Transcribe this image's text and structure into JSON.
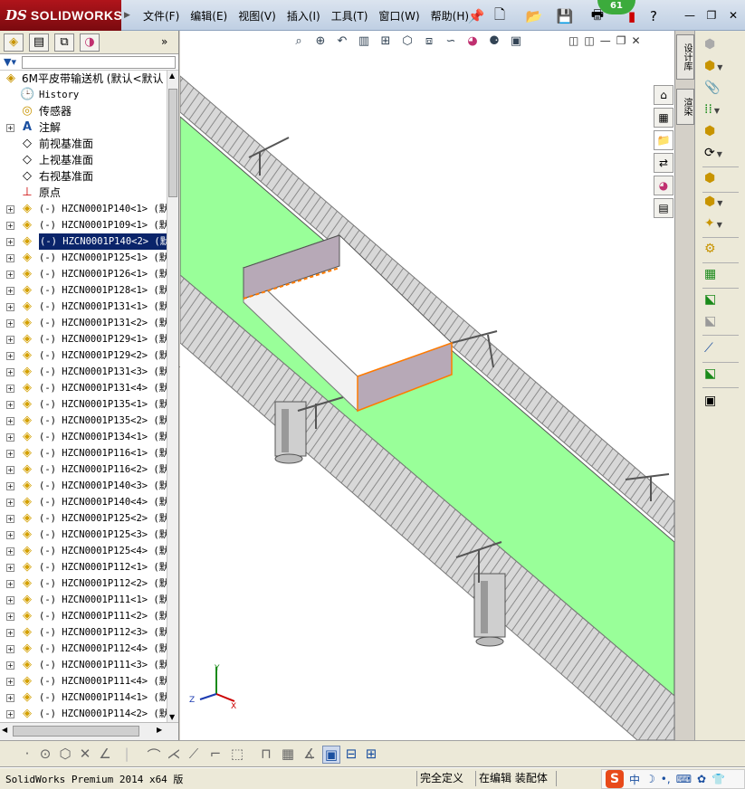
{
  "app": {
    "logo_ds": "DS",
    "logo_name": "SOLIDWORKS"
  },
  "menu": [
    "文件(F)",
    "编辑(E)",
    "视图(V)",
    "插入(I)",
    "工具(T)",
    "窗口(W)",
    "帮助(H)"
  ],
  "badge": "61",
  "tree": {
    "root": "6M平皮带输送机  (默认<默认",
    "fixed_items": [
      {
        "label": "History",
        "icon": "history-icon"
      },
      {
        "label": "传感器",
        "icon": "sensor-icon"
      },
      {
        "label": "注解",
        "icon": "annotation-icon"
      },
      {
        "label": "前视基准面",
        "icon": "plane-icon"
      },
      {
        "label": "上视基准面",
        "icon": "plane-icon"
      },
      {
        "label": "右视基准面",
        "icon": "plane-icon"
      },
      {
        "label": "原点",
        "icon": "origin-icon"
      }
    ],
    "components": [
      "(-) HZCN0001P140<1> (默",
      "(-) HZCN0001P109<1> (默",
      "(-) HZCN0001P140<2> (默",
      "(-) HZCN0001P125<1> (默",
      "(-) HZCN0001P126<1> (默",
      "(-) HZCN0001P128<1> (默",
      "(-) HZCN0001P131<1> (默",
      "(-) HZCN0001P131<2> (默",
      "(-) HZCN0001P129<1> (默",
      "(-) HZCN0001P129<2> (默",
      "(-) HZCN0001P131<3> (默",
      "(-) HZCN0001P131<4> (默",
      "(-) HZCN0001P135<1> (默",
      "(-) HZCN0001P135<2> (默",
      "(-) HZCN0001P134<1> (默",
      "(-) HZCN0001P116<1> (默",
      "(-) HZCN0001P116<2> (默",
      "(-) HZCN0001P140<3> (默",
      "(-) HZCN0001P140<4> (默",
      "(-) HZCN0001P125<2> (默",
      "(-) HZCN0001P125<3> (默",
      "(-) HZCN0001P125<4> (默",
      "(-) HZCN0001P112<1> (默",
      "(-) HZCN0001P112<2> (默",
      "(-) HZCN0001P111<1> (默",
      "(-) HZCN0001P111<2> (默",
      "(-) HZCN0001P112<3> (默",
      "(-) HZCN0001P112<4> (默",
      "(-) HZCN0001P111<3> (默",
      "(-) HZCN0001P111<4> (默",
      "(-) HZCN0001P114<1> (默",
      "(-) HZCN0001P114<2> (默"
    ],
    "selected_index": 2
  },
  "axes": {
    "x": "X",
    "y": "Y",
    "z": "Z"
  },
  "taskpane": {
    "tab1": "设计库",
    "tab2": "渲染"
  },
  "status": {
    "app": "SolidWorks Premium 2014 x64 版",
    "define": "完全定义",
    "editing": "在编辑 装配体"
  },
  "ime": {
    "logo": "S",
    "lang": "中"
  },
  "colors": {
    "belt": "#99ff99",
    "selected_bg": "#0a246a",
    "plate": "#b7a9b7",
    "logo_red": "#a0141b"
  }
}
